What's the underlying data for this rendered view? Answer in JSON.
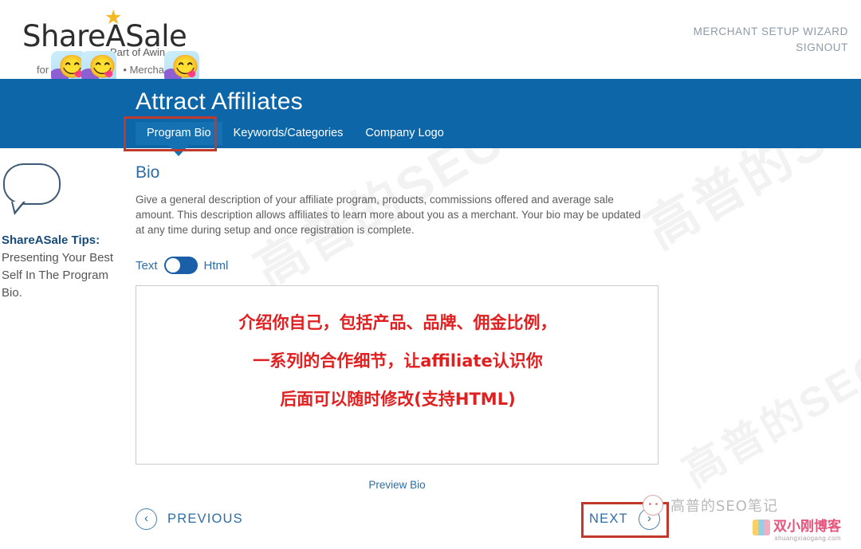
{
  "brand": {
    "logo_text": "ShareASale",
    "logo_tagline": "Part of Awin",
    "logo_for": "for",
    "account_label": "• Merchant 1",
    "star_icon": "★"
  },
  "top_links": [
    {
      "label": "MERCHANT SETUP WIZARD"
    },
    {
      "label": "SIGNOUT"
    }
  ],
  "header": {
    "title": "Attract Affiliates",
    "accent_color": "#0c66a8",
    "active_tab_color": "#1571b2",
    "highlight_color": "#c0392b"
  },
  "tabs": [
    {
      "label": "Program Bio",
      "active": true
    },
    {
      "label": "Keywords/Categories",
      "active": false
    },
    {
      "label": "Company Logo",
      "active": false
    }
  ],
  "tips": {
    "title": "ShareASale Tips",
    "title_suffix": ":",
    "body": "Presenting Your Best Self In The Program Bio."
  },
  "main": {
    "section_title": "Bio",
    "description": "Give a general description of your affiliate program, products, commissions offered and average sale amount. This description allows affiliates to learn more about you as a merchant. Your bio may be updated at any time during setup and once registration is complete.",
    "toggle_left_label": "Text",
    "toggle_right_label": "Html",
    "toggle_state": "Text",
    "bio_value": "",
    "preview_link": "Preview Bio"
  },
  "annotation": {
    "line1": "介绍你自己，包括产品、品牌、佣金比例，",
    "line2": "一系列的合作细节，让affiliate认识你",
    "line3": "后面可以随时修改(支持HTML)",
    "color": "#e02020"
  },
  "footer": {
    "previous_label": "PREVIOUS",
    "next_label": "NEXT",
    "prev_icon": "‹",
    "next_icon": "›"
  },
  "watermarks": {
    "diagonal": "高普的SEO笔记",
    "brand_text": "高普的SEO笔记",
    "blog_name": "双小刚博客",
    "blog_url": "shuangxiaogang.com"
  }
}
